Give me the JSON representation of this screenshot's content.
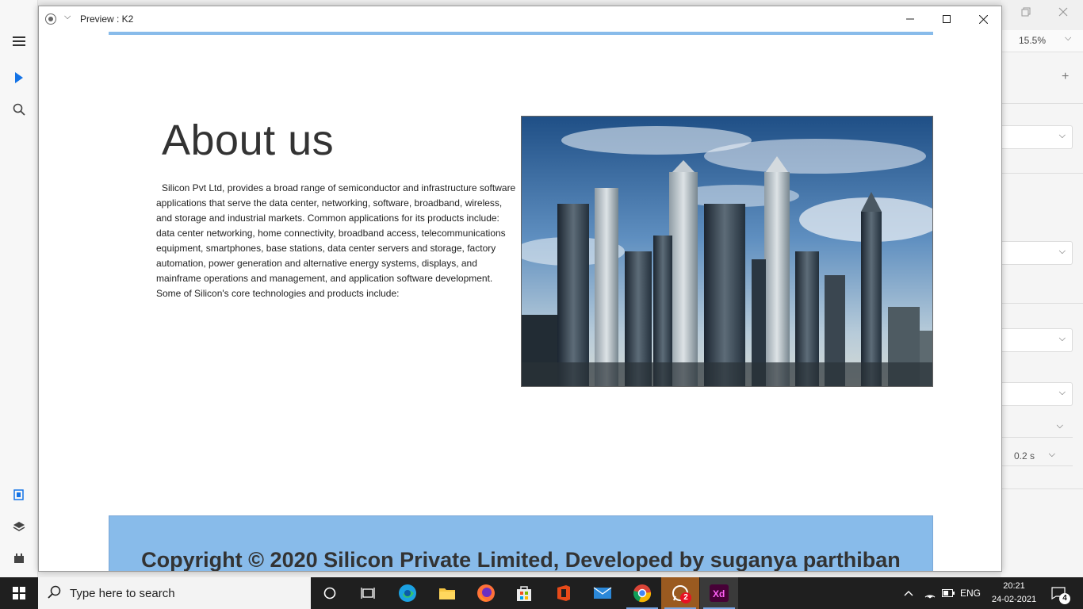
{
  "app": {
    "right_panel": {
      "zoom_value": "15.5%",
      "duration_value": "0.2 s"
    }
  },
  "preview_window": {
    "title": "Preview : K2"
  },
  "page": {
    "about_title": "About us",
    "about_paragraph": "Silicon Pvt Ltd, provides a broad range of semiconductor and infrastructure software applications that serve the data center, networking, software, broadband, wireless, and storage and industrial markets. Common applications for its products include: data center networking, home connectivity, broadband access, telecommunications equipment, smartphones, base stations, data center servers and storage, factory automation, power generation and alternative energy systems, displays, and mainframe operations and management, and application software development. Some of Silicon's core technologies and products include:",
    "footer_text": "Copyright © 2020 Silicon Private Limited, Developed by suganya parthiban",
    "band_color": "#88bbea"
  },
  "taskbar": {
    "search_placeholder": "Type here to search",
    "whatsapp_badge": "2",
    "language": "ENG",
    "time": "20:21",
    "date": "24-02-2021",
    "notifications_count": "4"
  }
}
